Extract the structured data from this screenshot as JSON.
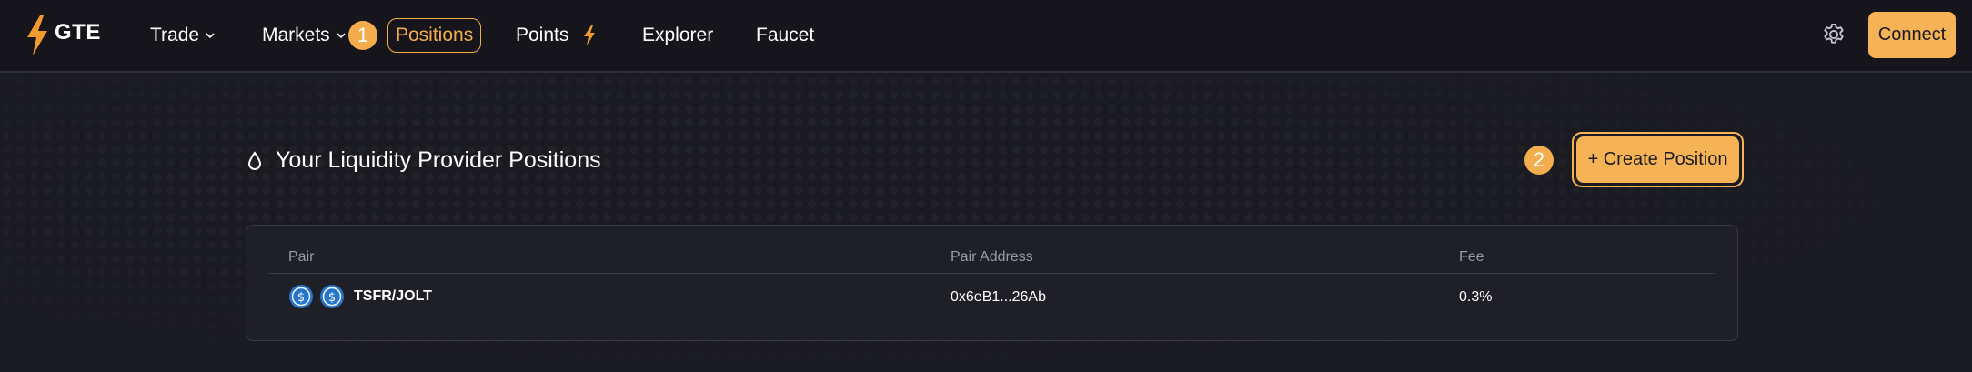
{
  "header": {
    "logo_text": "GTE",
    "nav": [
      {
        "label": "Trade",
        "has_dropdown": true
      },
      {
        "label": "Markets",
        "has_dropdown": true
      },
      {
        "label": "Positions",
        "active": true
      },
      {
        "label": "Points",
        "has_bolt": true
      },
      {
        "label": "Explorer"
      },
      {
        "label": "Faucet"
      }
    ],
    "connect_label": "Connect"
  },
  "annotations": {
    "badge1": "1",
    "badge2": "2"
  },
  "main": {
    "title": "Your Liquidity Provider Positions",
    "create_button_label": "+ Create Position"
  },
  "table": {
    "columns": [
      "Pair",
      "Pair Address",
      "Fee"
    ],
    "rows": [
      {
        "pair": "TSFR/JOLT",
        "address": "0x6eB1...26Ab",
        "fee": "0.3%"
      }
    ]
  },
  "colors": {
    "accent": "#f6b356",
    "background": "#1a1a21",
    "coin": "#2775ca"
  },
  "icons": [
    "bolt-logo-icon",
    "chevron-down-icon",
    "bolt-icon",
    "gear-icon",
    "droplet-icon",
    "usdc-coin-icon"
  ]
}
